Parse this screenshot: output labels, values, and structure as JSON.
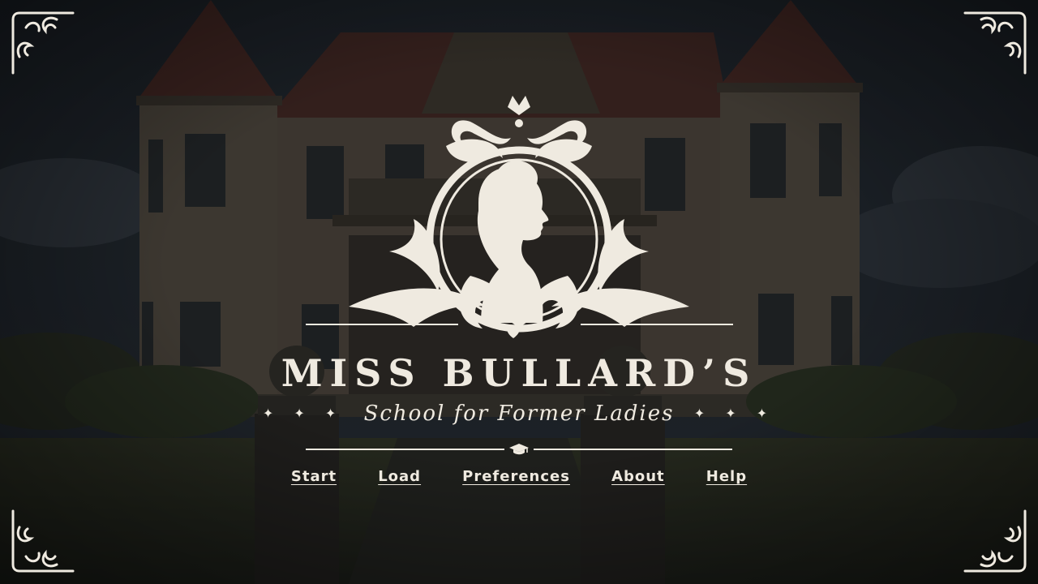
{
  "title": {
    "main": "MISS BULLARD’S",
    "subtitle": "School for Former Ladies",
    "ornament_left": "✦ ✦ ✦",
    "ornament_right": "✦ ✦ ✦"
  },
  "menu": {
    "items": [
      {
        "label": "Start"
      },
      {
        "label": "Load"
      },
      {
        "label": "Preferences"
      },
      {
        "label": "About"
      },
      {
        "label": "Help"
      }
    ]
  },
  "icons": {
    "emblem": "lady-silhouette-crest-icon",
    "divider": "graduation-cap-icon",
    "corners": "flourish-corner-icon"
  },
  "colors": {
    "ivory": "#efeae0",
    "background": "#151617",
    "roof": "#6e2c26"
  }
}
